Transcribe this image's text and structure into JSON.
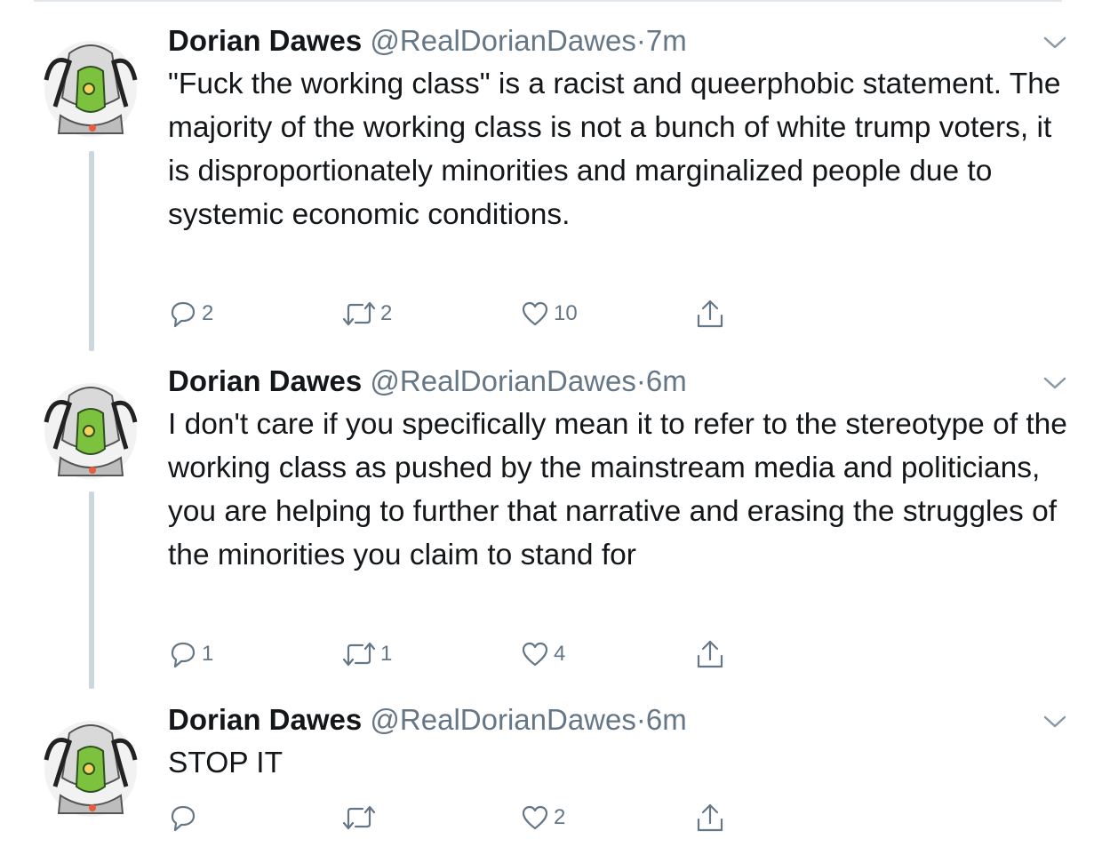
{
  "colors": {
    "text": "#14171a",
    "secondary": "#657786",
    "thread_line": "#ccd6dd",
    "divider": "#e1e8ed",
    "avatar_accent": "#7cc23f"
  },
  "icons": {
    "reply": "reply-icon",
    "retweet": "retweet-icon",
    "like": "heart-icon",
    "share": "share-icon",
    "more": "chevron-down-icon"
  },
  "tweets": [
    {
      "name": "Dorian Dawes",
      "handle": "@RealDorianDawes",
      "separator": "·",
      "time": "7m",
      "text": "\"Fuck the working class\" is a racist and queerphobic statement. The majority of the working class is not a bunch of white trump voters, it is disproportionately minorities and marginalized people due to systemic economic conditions.",
      "replies": "2",
      "retweets": "2",
      "likes": "10"
    },
    {
      "name": "Dorian Dawes",
      "handle": "@RealDorianDawes",
      "separator": "·",
      "time": "6m",
      "text": "I don't care if you specifically mean it to refer to the stereotype of the working class as pushed by the mainstream media and politicians, you are helping to further that narrative and erasing the struggles of the minorities you claim to stand for",
      "replies": "1",
      "retweets": "1",
      "likes": "4"
    },
    {
      "name": "Dorian Dawes",
      "handle": "@RealDorianDawes",
      "separator": "·",
      "time": "6m",
      "text": "STOP IT",
      "replies": "",
      "retweets": "",
      "likes": "2"
    }
  ]
}
